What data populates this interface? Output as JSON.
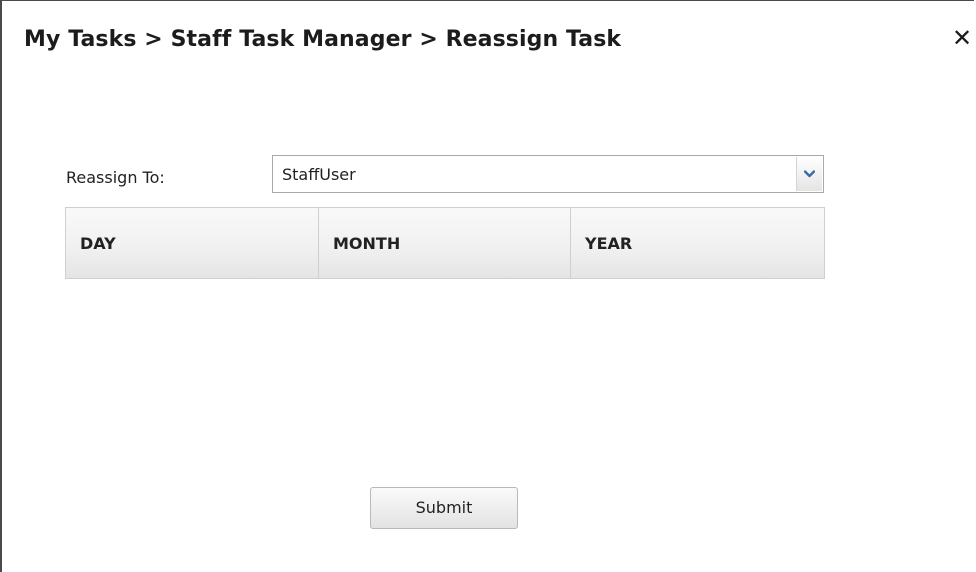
{
  "header": {
    "breadcrumb": "My Tasks > Staff Task Manager > Reassign Task",
    "close_icon": "close-icon",
    "close_glyph": "✕"
  },
  "form": {
    "reassign_label": "Reassign To:",
    "reassign_value": "StaffUser",
    "dropdown_icon": "chevron-down-icon"
  },
  "grid": {
    "columns": [
      "DAY",
      "MONTH",
      "YEAR"
    ],
    "rows": []
  },
  "actions": {
    "submit_label": "Submit"
  },
  "colors": {
    "text": "#222222",
    "border": "#cfcfcf",
    "chevron": "#3a6aa8"
  }
}
